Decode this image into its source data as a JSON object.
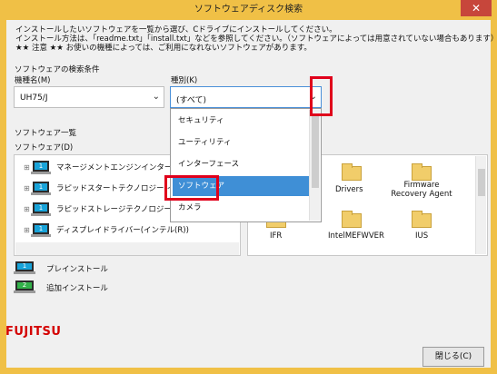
{
  "window": {
    "title": "ソフトウェアディスク検索",
    "close_glyph": "✕"
  },
  "intro": {
    "line1": "インストールしたいソフトウェアを一覧から選び、Cドライブにインストールしてください。",
    "line2": "インストール方法は、「readme.txt」「install.txt」などを参照してください。（ソフトウェアによっては用意されていない場合もあります）",
    "line3": "★★ 注意 ★★ お使いの機種によっては、ご利用になれないソフトウェアがあります。"
  },
  "search": {
    "group_label": "ソフトウェアの検索条件",
    "model_label": "機種名(M)",
    "model_value": "UH75/J",
    "type_label": "種別(K)",
    "type_value": "(すべて)",
    "type_options": [
      "セキュリティ",
      "ユーティリティ",
      "インターフェース",
      "ソフトウェア",
      "カメラ"
    ],
    "type_selected": "ソフトウェア"
  },
  "list": {
    "group_label": "ソフトウェア一覧",
    "software_label": "ソフトウェア(D)",
    "items": [
      "マネージメントエンジンインターフ",
      "ラピッドスタートテクノロジー(イ",
      "ラピッドストレージテクノロジー(イ",
      "ディスプレイドライバー(インテル(R))"
    ],
    "folders": [
      "Drivers",
      "Firmware Recovery Agent",
      "IFR",
      "IntelMEFWVER",
      "IUS"
    ]
  },
  "legend": {
    "preinstall": "プレインストール",
    "additional": "追加インストール"
  },
  "footer": {
    "logo": "FUJITSU",
    "close_button": "閉じる(C)"
  },
  "icons": {
    "pc": "pc-icon",
    "expander": "⊞",
    "chevron": "⌄"
  },
  "colors": {
    "title_bar": "#f0c046",
    "selection": "#3f8fd6",
    "highlight": "#e0001b"
  }
}
